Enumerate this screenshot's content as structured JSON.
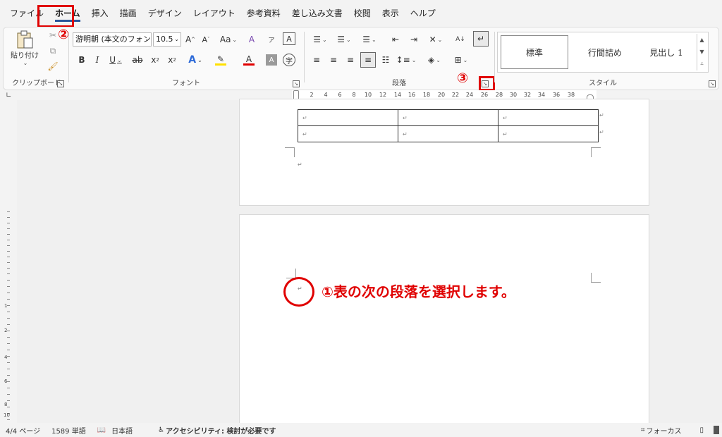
{
  "menu": {
    "tabs": [
      "ファイル",
      "ホーム",
      "挿入",
      "描画",
      "デザイン",
      "レイアウト",
      "参考資料",
      "差し込み文書",
      "校閲",
      "表示",
      "ヘルプ"
    ],
    "active_index": 1
  },
  "ribbon": {
    "clipboard": {
      "label": "クリップボード",
      "paste_label": "貼り付け"
    },
    "font": {
      "label": "フォント",
      "font_name": "游明朝 (本文のフォン",
      "font_size": "10.5",
      "case_label": "Aa"
    },
    "paragraph": {
      "label": "段落"
    },
    "styles": {
      "label": "スタイル",
      "items": [
        "標準",
        "行間詰め",
        "見出し 1"
      ]
    }
  },
  "ruler": {
    "numbers": [
      "2",
      "4",
      "6",
      "8",
      "10",
      "12",
      "14",
      "16",
      "18",
      "20",
      "22",
      "24",
      "26",
      "28",
      "30",
      "32",
      "34",
      "36",
      "38"
    ]
  },
  "vruler": {
    "numbers": [
      "1",
      "2",
      "4",
      "6",
      "8",
      "10"
    ]
  },
  "annotations": {
    "step1": "①表の次の段落を選択します。",
    "step2": "②",
    "step3": "③"
  },
  "paragraph_mark": "↵",
  "status": {
    "page": "4/4 ページ",
    "words": "1589 単語",
    "language": "日本語",
    "accessibility": "アクセシビリティ: 検討が必要です",
    "focus": "フォーカス"
  },
  "colors": {
    "accent": "#2b579a",
    "annotation": "#e00000"
  }
}
